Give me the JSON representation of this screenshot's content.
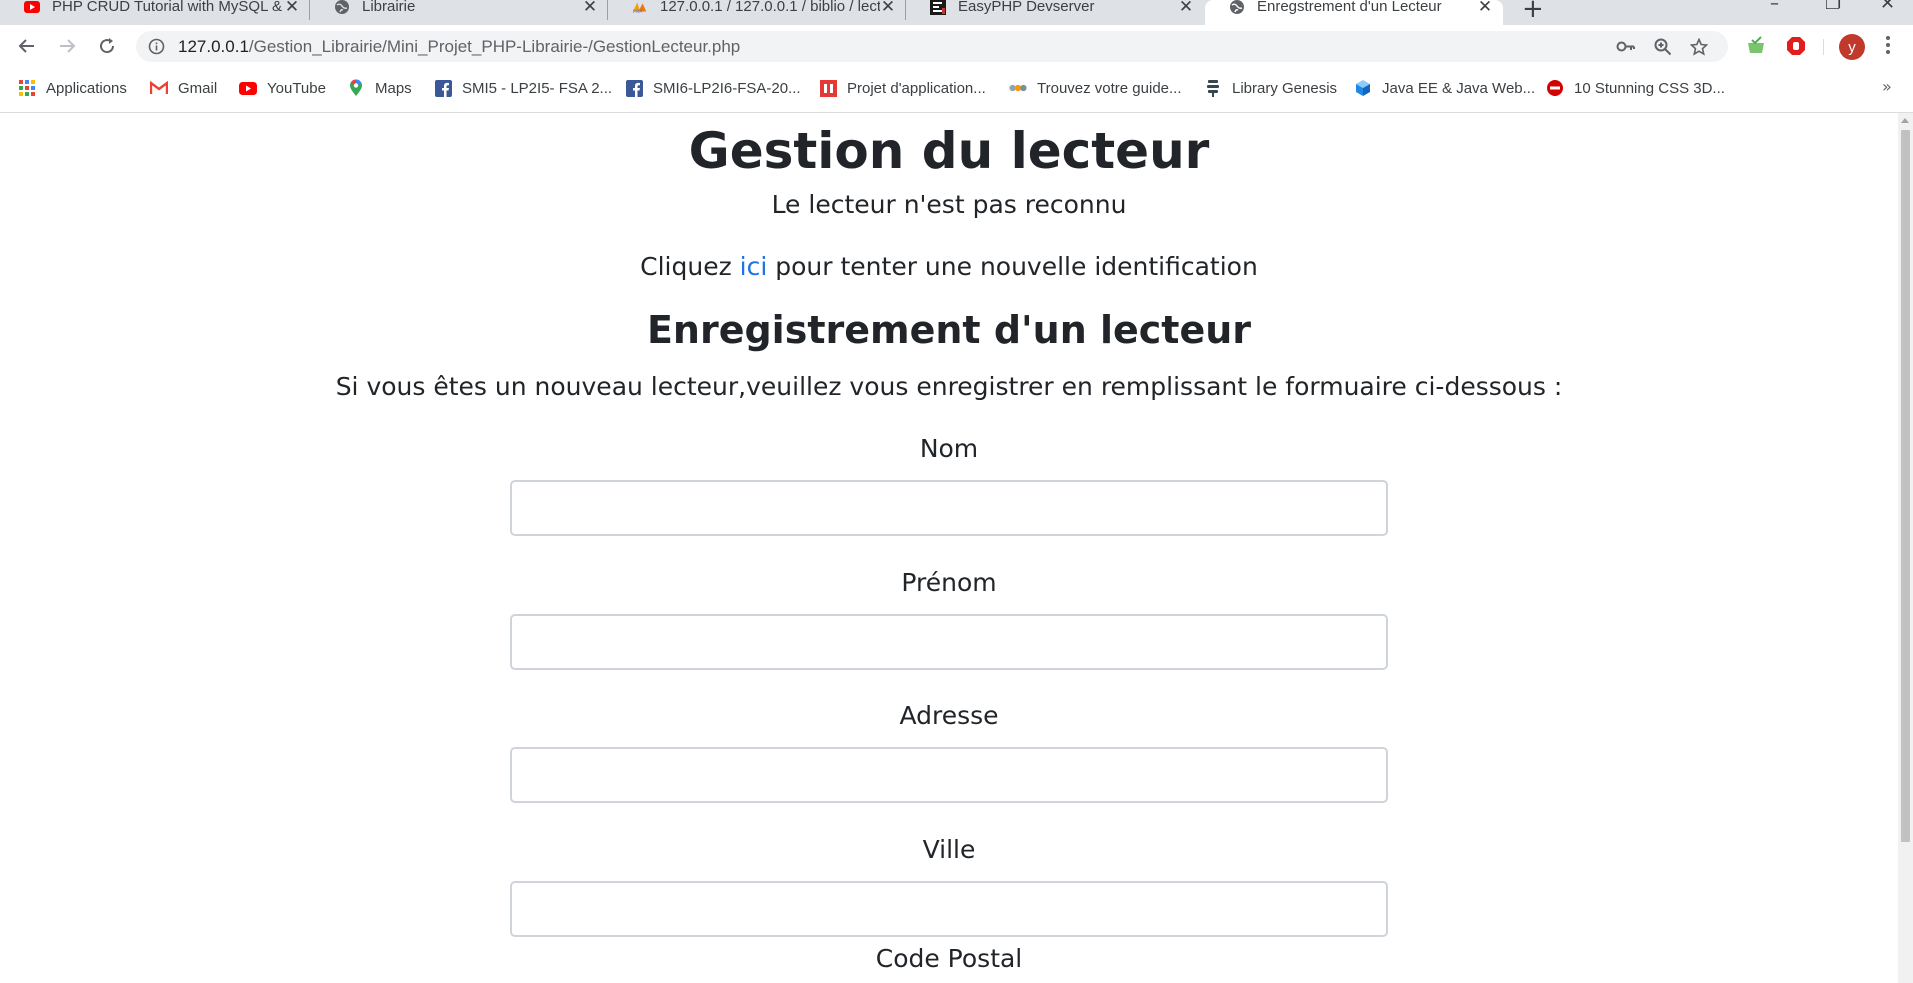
{
  "browser": {
    "tabs": [
      {
        "title": "PHP CRUD Tutorial with MySQL &",
        "icon": "youtube-icon",
        "active": false
      },
      {
        "title": "Librairie",
        "icon": "globe-icon",
        "active": false
      },
      {
        "title": "127.0.0.1 / 127.0.0.1 / biblio / lect",
        "icon": "phpmyadmin-icon",
        "active": false
      },
      {
        "title": "EasyPHP Devserver",
        "icon": "easyphp-icon",
        "active": false
      },
      {
        "title": "Enregstrement d'un Lecteur",
        "icon": "globe-icon",
        "active": true
      }
    ],
    "new_tab_label": "+",
    "address": {
      "host": "127.0.0.1",
      "path": "/Gestion_Librairie/Mini_Projet_PHP-Librairie-/GestionLecteur.php"
    },
    "profile_initial": "y",
    "bookmarks": [
      {
        "label": "Applications",
        "icon": "apps-grid-icon"
      },
      {
        "label": "Gmail",
        "icon": "gmail-icon"
      },
      {
        "label": "YouTube",
        "icon": "youtube-icon"
      },
      {
        "label": "Maps",
        "icon": "maps-icon"
      },
      {
        "label": "SMI5 - LP2I5- FSA 2...",
        "icon": "facebook-icon"
      },
      {
        "label": "SMI6-LP2I6-FSA-20...",
        "icon": "facebook-icon"
      },
      {
        "label": "Projet d'application...",
        "icon": "projet-icon"
      },
      {
        "label": "Trouvez votre guide...",
        "icon": "guide-icon"
      },
      {
        "label": "Library Genesis",
        "icon": "library-genesis-icon"
      },
      {
        "label": "Java EE & Java Web...",
        "icon": "java-cube-icon"
      },
      {
        "label": "10 Stunning CSS 3D...",
        "icon": "stop-sign-icon"
      }
    ],
    "bookmarks_more": "»"
  },
  "page": {
    "title": "Gestion du lecteur",
    "status": "Le lecteur n'est pas reconnu",
    "retry_prefix": "Cliquez ",
    "retry_link": "ici",
    "retry_suffix": " pour tenter une nouvelle identification",
    "register_title": "Enregistrement d'un lecteur",
    "register_intro": "Si vous êtes un nouveau lecteur,veuillez vous enregistrer en remplissant le formuaire ci-dessous :",
    "fields": [
      {
        "label": "Nom",
        "value": ""
      },
      {
        "label": "Prénom",
        "value": ""
      },
      {
        "label": "Adresse",
        "value": ""
      },
      {
        "label": "Ville",
        "value": ""
      },
      {
        "label": "Code Postal",
        "value": ""
      }
    ]
  },
  "colors": {
    "link": "#1a73e8",
    "text": "#212529",
    "tabstrip": "#dee1e6",
    "input_border": "#ced4da"
  }
}
